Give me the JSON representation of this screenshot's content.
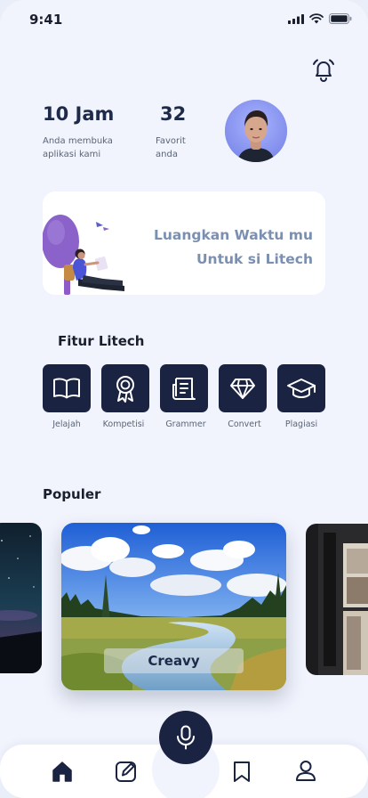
{
  "status_bar": {
    "time": "9:41"
  },
  "stats": {
    "hours": {
      "value": "10 Jam",
      "label": "Anda membuka\naplikasi kami"
    },
    "favorites": {
      "value": "32",
      "label": "Favorit\nanda"
    }
  },
  "banner": {
    "line1": "Luangkan Waktu mu",
    "line2": "Untuk si Litech"
  },
  "features": {
    "title": "Fitur Litech",
    "items": [
      {
        "label": "Jelajah",
        "icon": "book-icon"
      },
      {
        "label": "Kompetisi",
        "icon": "award-icon"
      },
      {
        "label": "Grammer",
        "icon": "newspaper-icon"
      },
      {
        "label": "Convert",
        "icon": "diamond-icon"
      },
      {
        "label": "Plagiasi",
        "icon": "graduation-cap-icon"
      }
    ]
  },
  "popular": {
    "title": "Populer",
    "featured_label": "Creavy"
  },
  "nav": {
    "items": [
      "home-icon",
      "edit-icon",
      "bookmark-icon",
      "user-icon"
    ],
    "center": "microphone-icon",
    "active": "home-icon"
  },
  "colors": {
    "primary": "#1a2341",
    "background": "#f1f4fd",
    "accent_text": "#7b8fb0"
  }
}
